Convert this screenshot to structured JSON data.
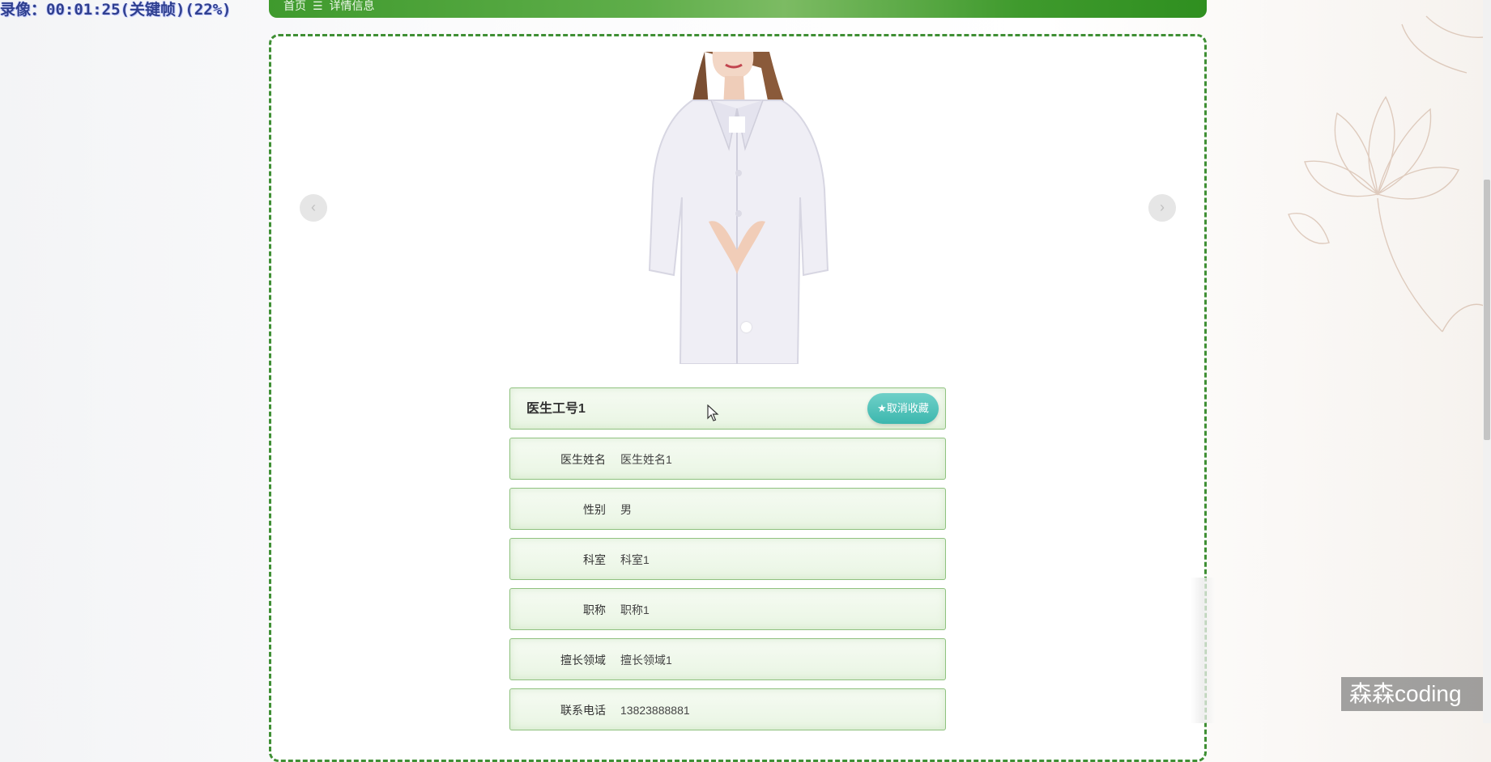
{
  "overlay": {
    "timer_text": "录像：00:01:25(关键帧)(22%)"
  },
  "breadcrumb": {
    "home": "首页",
    "separator": "☰",
    "current": "详情信息"
  },
  "carousel": {
    "prev_glyph": "‹",
    "next_glyph": "›"
  },
  "detail": {
    "title": "医生工号1",
    "favorite_button": "★取消收藏",
    "fields": [
      {
        "label": "医生姓名",
        "value": "医生姓名1"
      },
      {
        "label": "性别",
        "value": "男"
      },
      {
        "label": "科室",
        "value": "科室1"
      },
      {
        "label": "职称",
        "value": "职称1"
      },
      {
        "label": "擅长领域",
        "value": "擅长领域1"
      },
      {
        "label": "联系电话",
        "value": "13823888881"
      }
    ]
  },
  "watermark": {
    "text": "森森coding"
  },
  "colors": {
    "accent_green": "#3f9a2d",
    "field_border": "#8fc27f",
    "fav_button": "#3cb7ae"
  }
}
